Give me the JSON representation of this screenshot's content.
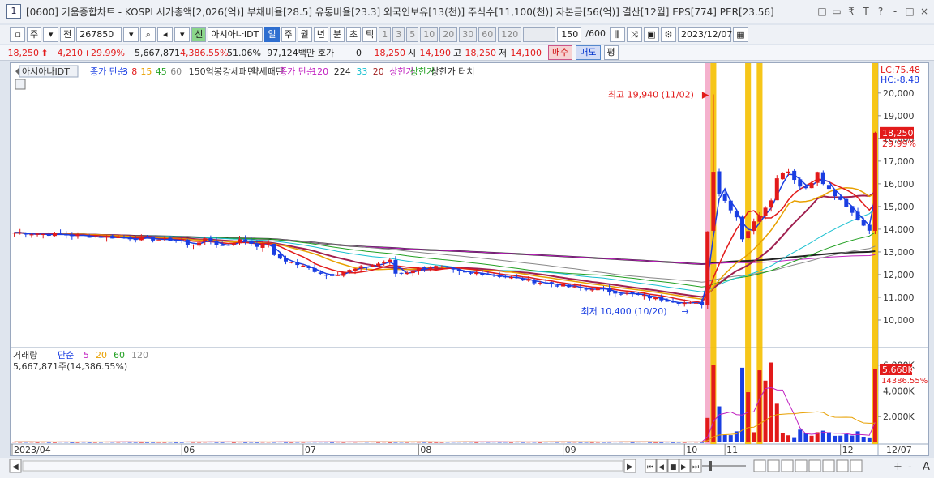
{
  "window": {
    "number": "1",
    "title": "[0600] 키움종합차트 - KOSPI 시가총액[2,026(억)] 부채비율[28.5] 유통비율[23.3] 외국인보유[13(천)] 주식수[11,100(천)] 자본금[56(억)] 결산[12월] EPS[774] PER[23.56]",
    "buttons": [
      "□",
      "▭",
      "₹",
      "T",
      "?",
      "-",
      "□",
      "×"
    ]
  },
  "toolbar": {
    "type_label": "주",
    "prev_label": "전",
    "code": "267850",
    "stock_tag": "신",
    "stock_name": "아시아나IDT",
    "periods": [
      "일",
      "주",
      "월",
      "년",
      "분",
      "초",
      "틱"
    ],
    "active_period": "일",
    "intervals": [
      "1",
      "3",
      "5",
      "10",
      "20",
      "30",
      "60",
      "120"
    ],
    "count": "150",
    "count_total": "/600",
    "date": "2023/12/07"
  },
  "pricebar": {
    "price": "18,250",
    "change": "4,210",
    "change_pct": "+29.99%",
    "volume": "5,667,871",
    "volume_pct": "4,386.55%",
    "rate": "51.06%",
    "amount": "97,124백만",
    "quote_label": "호가",
    "quote_value": "0",
    "quote_price": "18,250",
    "open_label": "시",
    "open": "14,190",
    "high_label": "고",
    "high": "18,250",
    "low_label": "저",
    "low": "14,100",
    "buy_label": "매수",
    "sell_label": "매도",
    "flat_label": "평"
  },
  "legend": {
    "stock": "아시아나IDT",
    "ma_label": "종가 단순",
    "ma_periods": [
      "3",
      "8",
      "15",
      "45",
      "60"
    ],
    "ma_periods_colors": [
      "#1a3ee2",
      "#e21a1a",
      "#e8a000",
      "#22a022",
      "#888888"
    ],
    "pattern1": "150억봉",
    "pattern2": "강세패턴",
    "pattern3": "약세패턴",
    "ma2_label": "종가 단순",
    "ma2_periods": [
      "120",
      "224",
      "33",
      "20"
    ],
    "ma2_colors": [
      "#c020c0",
      "#222222",
      "#18c0d0",
      "#a02020"
    ],
    "upper1": "상한가",
    "upper2": "상한가",
    "upper3": "상한가 터치"
  },
  "price_axis": {
    "ticks": [
      "20,000",
      "19,000",
      "18,000",
      "17,000",
      "16,000",
      "15,000",
      "14,000",
      "13,000",
      "12,000",
      "11,000",
      "10,000"
    ],
    "lc": "LC:75.48",
    "hc": "HC:-8.48",
    "last_price": "18,250",
    "last_pct": "29.99%"
  },
  "annotations": {
    "high": "최고 19,940 (11/02)",
    "low": "최저 10,400 (10/20)"
  },
  "volume_panel": {
    "title": "거래량",
    "ma_label": "단순",
    "ma_periods": [
      "5",
      "20",
      "60",
      "120"
    ],
    "ma_colors": [
      "#c020c0",
      "#e8a000",
      "#22a022",
      "#888888"
    ],
    "current": "5,667,871주(14,386.55%)",
    "ticks": [
      "6,000K",
      "4,000K",
      "2,000K"
    ],
    "last_vol": "5,668K",
    "last_pct": "14386.55%"
  },
  "date_axis": {
    "labels": [
      "2023/04",
      "06",
      "07",
      "08",
      "09",
      "10",
      "11",
      "12"
    ],
    "right_label": "12/07"
  },
  "bottombar": {
    "nav": [
      "◀",
      "▶",
      "⏮",
      "◀",
      "■",
      "▶",
      "⏭"
    ],
    "tools": [
      "+",
      "-",
      "A"
    ]
  },
  "chart_data": {
    "type": "candlestick",
    "title": "",
    "y_range": [
      9000,
      20600
    ],
    "n_bars": 150,
    "ma_series_names": [
      "3",
      "8",
      "15",
      "45",
      "60",
      "120",
      "224",
      "33",
      "20"
    ],
    "key_points": {
      "high": 19940,
      "low": 10400,
      "last_close": 18250
    },
    "volume_range": [
      0,
      6800000
    ]
  }
}
